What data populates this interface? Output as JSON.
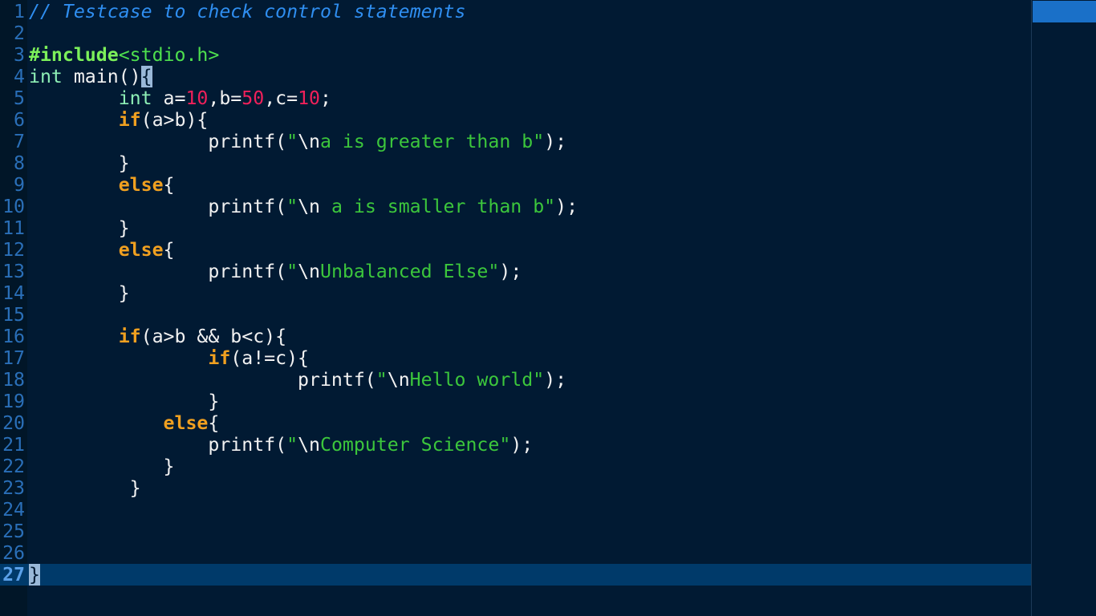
{
  "colors": {
    "background": "#011a33",
    "gutter": "#011628",
    "line_number": "#2a6fb8",
    "current_line": "#003a6a",
    "comment": "#2f8ef0",
    "preprocessor": "#7cf05a",
    "type": "#8ef0b6",
    "keyword": "#f0a020",
    "number": "#f0205a",
    "string": "#3cc63c",
    "text": "#f2f2f2",
    "scroll_thumb": "#1a70c8"
  },
  "editor": {
    "current_line": 27,
    "lines": [
      {
        "n": "1",
        "tokens": [
          {
            "t": "// Testcase to check control statements",
            "c": "comment"
          }
        ]
      },
      {
        "n": "2",
        "tokens": []
      },
      {
        "n": "3",
        "tokens": [
          {
            "t": "#include",
            "c": "preproc"
          },
          {
            "t": "<stdio.h>",
            "c": "header"
          }
        ]
      },
      {
        "n": "4",
        "tokens": [
          {
            "t": "int",
            "c": "type"
          },
          {
            "t": " main()",
            "c": "plain"
          },
          {
            "t": "{",
            "c": "cursor"
          }
        ]
      },
      {
        "n": "5",
        "tokens": [
          {
            "t": "        ",
            "c": "plain"
          },
          {
            "t": "int",
            "c": "type"
          },
          {
            "t": " a=",
            "c": "plain"
          },
          {
            "t": "10",
            "c": "num"
          },
          {
            "t": ",b=",
            "c": "plain"
          },
          {
            "t": "50",
            "c": "num"
          },
          {
            "t": ",c=",
            "c": "plain"
          },
          {
            "t": "10",
            "c": "num"
          },
          {
            "t": ";",
            "c": "plain"
          }
        ]
      },
      {
        "n": "6",
        "tokens": [
          {
            "t": "        ",
            "c": "plain"
          },
          {
            "t": "if",
            "c": "kw"
          },
          {
            "t": "(a>b){",
            "c": "plain"
          }
        ]
      },
      {
        "n": "7",
        "tokens": [
          {
            "t": "                printf(",
            "c": "plain"
          },
          {
            "t": "\"",
            "c": "str"
          },
          {
            "t": "\\n",
            "c": "esc"
          },
          {
            "t": "a is greater than b\"",
            "c": "str"
          },
          {
            "t": ");",
            "c": "plain"
          }
        ]
      },
      {
        "n": "8",
        "tokens": [
          {
            "t": "        }",
            "c": "plain"
          }
        ]
      },
      {
        "n": "9",
        "tokens": [
          {
            "t": "        ",
            "c": "plain"
          },
          {
            "t": "else",
            "c": "kw"
          },
          {
            "t": "{",
            "c": "plain"
          }
        ]
      },
      {
        "n": "10",
        "tokens": [
          {
            "t": "                printf(",
            "c": "plain"
          },
          {
            "t": "\"",
            "c": "str"
          },
          {
            "t": "\\n",
            "c": "esc"
          },
          {
            "t": " a is smaller than b\"",
            "c": "str"
          },
          {
            "t": ");",
            "c": "plain"
          }
        ]
      },
      {
        "n": "11",
        "tokens": [
          {
            "t": "        }",
            "c": "plain"
          }
        ]
      },
      {
        "n": "12",
        "tokens": [
          {
            "t": "        ",
            "c": "plain"
          },
          {
            "t": "else",
            "c": "kw"
          },
          {
            "t": "{",
            "c": "plain"
          }
        ]
      },
      {
        "n": "13",
        "tokens": [
          {
            "t": "                printf(",
            "c": "plain"
          },
          {
            "t": "\"",
            "c": "str"
          },
          {
            "t": "\\n",
            "c": "esc"
          },
          {
            "t": "Unbalanced Else\"",
            "c": "str"
          },
          {
            "t": ");",
            "c": "plain"
          }
        ]
      },
      {
        "n": "14",
        "tokens": [
          {
            "t": "        }",
            "c": "plain"
          }
        ]
      },
      {
        "n": "15",
        "tokens": []
      },
      {
        "n": "16",
        "tokens": [
          {
            "t": "        ",
            "c": "plain"
          },
          {
            "t": "if",
            "c": "kw"
          },
          {
            "t": "(a>b && b<c){",
            "c": "plain"
          }
        ]
      },
      {
        "n": "17",
        "tokens": [
          {
            "t": "                ",
            "c": "plain"
          },
          {
            "t": "if",
            "c": "kw"
          },
          {
            "t": "(a!=c){",
            "c": "plain"
          }
        ]
      },
      {
        "n": "18",
        "tokens": [
          {
            "t": "                        printf(",
            "c": "plain"
          },
          {
            "t": "\"",
            "c": "str"
          },
          {
            "t": "\\n",
            "c": "esc"
          },
          {
            "t": "Hello world\"",
            "c": "str"
          },
          {
            "t": ");",
            "c": "plain"
          }
        ]
      },
      {
        "n": "19",
        "tokens": [
          {
            "t": "                }",
            "c": "plain"
          }
        ]
      },
      {
        "n": "20",
        "tokens": [
          {
            "t": "            ",
            "c": "plain"
          },
          {
            "t": "else",
            "c": "kw"
          },
          {
            "t": "{",
            "c": "plain"
          }
        ]
      },
      {
        "n": "21",
        "tokens": [
          {
            "t": "                printf(",
            "c": "plain"
          },
          {
            "t": "\"",
            "c": "str"
          },
          {
            "t": "\\n",
            "c": "esc"
          },
          {
            "t": "Computer Science\"",
            "c": "str"
          },
          {
            "t": ");",
            "c": "plain"
          }
        ]
      },
      {
        "n": "22",
        "tokens": [
          {
            "t": "            }",
            "c": "plain"
          }
        ]
      },
      {
        "n": "23",
        "tokens": [
          {
            "t": "         }",
            "c": "plain"
          }
        ]
      },
      {
        "n": "24",
        "tokens": []
      },
      {
        "n": "25",
        "tokens": []
      },
      {
        "n": "26",
        "tokens": []
      },
      {
        "n": "27",
        "tokens": [
          {
            "t": "}",
            "c": "cursor"
          }
        ]
      }
    ]
  }
}
